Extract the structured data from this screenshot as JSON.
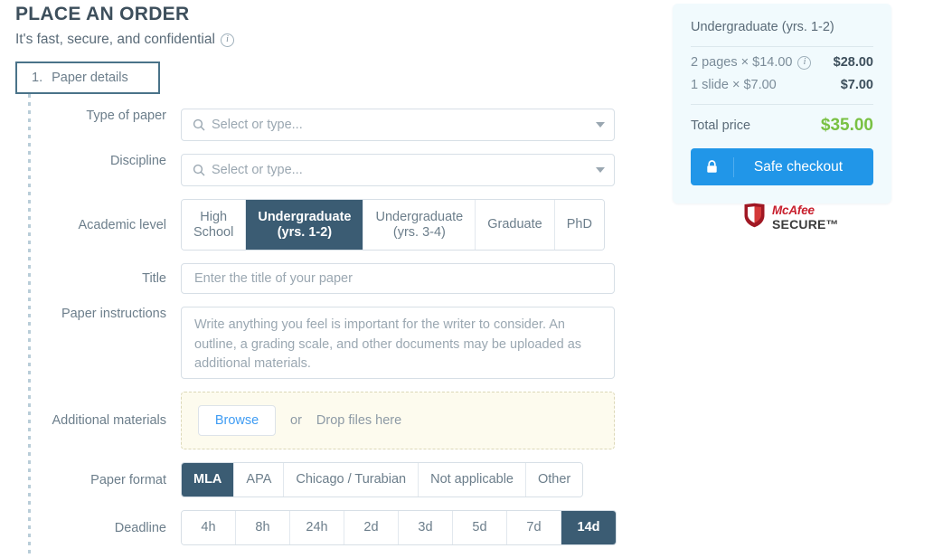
{
  "header": {
    "title": "PLACE AN ORDER",
    "subtitle": "It's fast, secure, and confidential",
    "info_icon": "info-icon"
  },
  "step_tab": {
    "number": "1.",
    "label": "Paper details"
  },
  "form": {
    "type_of_paper": {
      "label": "Type of paper",
      "placeholder": "Select or type...",
      "value": ""
    },
    "discipline": {
      "label": "Discipline",
      "placeholder": "Select or type...",
      "value": ""
    },
    "academic_level": {
      "label": "Academic level",
      "selected": "Undergraduate (yrs. 1-2)",
      "options": [
        "High\nSchool",
        "Undergraduate\n(yrs. 1-2)",
        "Undergraduate\n(yrs. 3-4)",
        "Graduate",
        "PhD"
      ]
    },
    "title": {
      "label": "Title",
      "placeholder": "Enter the title of your paper",
      "value": ""
    },
    "paper_instructions": {
      "label": "Paper instructions",
      "placeholder": "Write anything you feel is important for the writer to consider. An outline, a grading scale, and other documents may be uploaded as additional materials.",
      "value": ""
    },
    "additional_materials": {
      "label": "Additional materials",
      "browse_label": "Browse",
      "or_label": "or",
      "drop_label": "Drop files here"
    },
    "paper_format": {
      "label": "Paper format",
      "selected": "MLA",
      "options": [
        "MLA",
        "APA",
        "Chicago / Turabian",
        "Not applicable",
        "Other"
      ]
    },
    "deadline": {
      "label": "Deadline",
      "selected": "14d",
      "options": [
        "4h",
        "8h",
        "24h",
        "2d",
        "3d",
        "5d",
        "7d",
        "14d"
      ]
    }
  },
  "sidebar": {
    "academic_level": "Undergraduate (yrs. 1-2)",
    "line_items": [
      {
        "description": "2 pages × $14.00",
        "amount": "$28.00",
        "has_info": true
      },
      {
        "description": "1 slide × $7.00",
        "amount": "$7.00",
        "has_info": false
      }
    ],
    "total_label": "Total price",
    "total_amount": "$35.00",
    "checkout_label": "Safe checkout",
    "lock_icon": "lock-icon"
  },
  "trust_badge": {
    "name": "McAfee",
    "secure": "SECURE™"
  },
  "colors": {
    "accent_dark": "#3b5c73",
    "checkout_blue": "#2196e8",
    "total_green": "#79c143",
    "sidebar_bg": "#f1fafd",
    "dropzone_bg": "#fdfbee",
    "mcafee_red": "#c8202e"
  }
}
